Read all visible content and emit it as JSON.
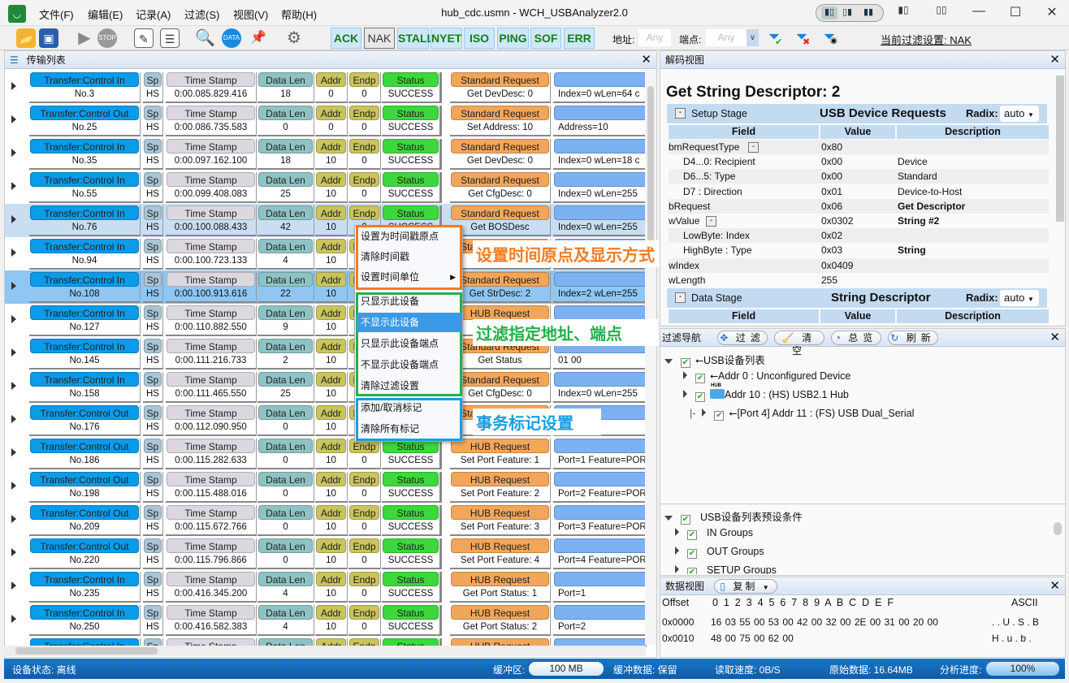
{
  "window": {
    "title": "hub_cdc.usmn - WCH_USBAnalyzer2.0",
    "menus": [
      "文件(F)",
      "编辑(E)",
      "记录(A)",
      "过滤(S)",
      "视图(V)",
      "帮助(H)"
    ]
  },
  "toolbar": {
    "packet_filters": [
      {
        "label": "ACK",
        "on": true
      },
      {
        "label": "NAK",
        "on": false
      },
      {
        "label": "STALL",
        "on": true
      },
      {
        "label": "NYET",
        "on": true
      },
      {
        "label": "ISO",
        "on": true
      },
      {
        "label": "PING",
        "on": true
      },
      {
        "label": "SOF",
        "on": true
      },
      {
        "label": "ERR",
        "on": true
      }
    ],
    "addr_label": "地址:",
    "addr_placeholder": "Any",
    "endp_label": "端点:",
    "endp_placeholder": "Any",
    "current_filter": "当前过滤设置:  NAK"
  },
  "transfer_list": {
    "title": "传输列表",
    "headers": {
      "sp": "Sp",
      "time": "Time Stamp",
      "len": "Data Len",
      "addr": "Addr",
      "endp": "Endp",
      "status": "Status"
    },
    "rows": [
      {
        "type": "Transfer:Control In",
        "no": "No.3",
        "sp": "HS",
        "time": "0:00.085.829.416",
        "len": "18",
        "addr": "0",
        "endp": "0",
        "status": "SUCCESS",
        "req": "Standard Request",
        "req_val": "Get DevDesc: 0",
        "desc": "Index=0  wLen=64  c"
      },
      {
        "type": "Transfer:Control Out",
        "no": "No.25",
        "sp": "HS",
        "time": "0:00.086.735.583",
        "len": "0",
        "addr": "0",
        "endp": "0",
        "status": "SUCCESS",
        "req": "Standard Request",
        "req_val": "Set Address: 10",
        "desc": "Address=10"
      },
      {
        "type": "Transfer:Control In",
        "no": "No.35",
        "sp": "HS",
        "time": "0:00.097.162.100",
        "len": "18",
        "addr": "10",
        "endp": "0",
        "status": "SUCCESS",
        "req": "Standard Request",
        "req_val": "Get DevDesc: 0",
        "desc": "Index=0  wLen=18  c"
      },
      {
        "type": "Transfer:Control In",
        "no": "No.55",
        "sp": "HS",
        "time": "0:00.099.408.083",
        "len": "25",
        "addr": "10",
        "endp": "0",
        "status": "SUCCESS",
        "req": "Standard Request",
        "req_val": "Get CfgDesc: 0",
        "desc": "Index=0  wLen=255"
      },
      {
        "type": "Transfer:Control In",
        "no": "No.76",
        "sp": "HS",
        "time": "0:00.100.088.433",
        "len": "42",
        "addr": "10",
        "endp": "0",
        "status": "SUCCESS",
        "req": "Standard Request",
        "req_val": "Get BOSDesc",
        "desc": "Index=0  wLen=255",
        "selected": 1
      },
      {
        "type": "Transfer:Control In",
        "no": "No.94",
        "sp": "HS",
        "time": "0:00.100.723.133",
        "len": "4",
        "addr": "10",
        "endp": "0",
        "status": "SUCCESS",
        "req": "Standard Request",
        "req_val": "G",
        "desc": ""
      },
      {
        "type": "Transfer:Control In",
        "no": "No.108",
        "sp": "HS",
        "time": "0:00.100.913.616",
        "len": "22",
        "addr": "10",
        "endp": "0",
        "status": "SUCCESS",
        "req": "Standard Request",
        "req_val": "Get StrDesc: 2",
        "desc": "Index=2  wLen=255",
        "selected": 2
      },
      {
        "type": "Transfer:Control In",
        "no": "No.127",
        "sp": "HS",
        "time": "0:00.110.882.550",
        "len": "9",
        "addr": "10",
        "endp": "0",
        "status": "SUCCESS",
        "req": "HUB Request",
        "req_val": "Get",
        "desc": ""
      },
      {
        "type": "Transfer:Control In",
        "no": "No.145",
        "sp": "HS",
        "time": "0:00.111.216.733",
        "len": "2",
        "addr": "10",
        "endp": "0",
        "status": "SUCCESS",
        "req": "Standard Request",
        "req_val": "Get Status",
        "desc": "01 00"
      },
      {
        "type": "Transfer:Control In",
        "no": "No.158",
        "sp": "HS",
        "time": "0:00.111.465.550",
        "len": "25",
        "addr": "10",
        "endp": "0",
        "status": "SUCCESS",
        "req": "Standard Request",
        "req_val": "Get CfgDesc: 0",
        "desc": "Index=0  wLen=255"
      },
      {
        "type": "Transfer:Control Out",
        "no": "No.176",
        "sp": "HS",
        "time": "0:00.112.090.950",
        "len": "0",
        "addr": "10",
        "endp": "0",
        "status": "SUCCESS",
        "req": "Standard Request",
        "req_val": "Set",
        "desc": "tion=1"
      },
      {
        "type": "Transfer:Control Out",
        "no": "No.186",
        "sp": "HS",
        "time": "0:00.115.282.633",
        "len": "0",
        "addr": "10",
        "endp": "0",
        "status": "SUCCESS",
        "req": "HUB Request",
        "req_val": "Set Port Feature: 1",
        "desc": "Port=1  Feature=POR"
      },
      {
        "type": "Transfer:Control Out",
        "no": "No.198",
        "sp": "HS",
        "time": "0:00.115.488.016",
        "len": "0",
        "addr": "10",
        "endp": "0",
        "status": "SUCCESS",
        "req": "HUB Request",
        "req_val": "Set Port Feature: 2",
        "desc": "Port=2  Feature=POR"
      },
      {
        "type": "Transfer:Control Out",
        "no": "No.209",
        "sp": "HS",
        "time": "0:00.115.672.766",
        "len": "0",
        "addr": "10",
        "endp": "0",
        "status": "SUCCESS",
        "req": "HUB Request",
        "req_val": "Set Port Feature: 3",
        "desc": "Port=3  Feature=POR"
      },
      {
        "type": "Transfer:Control Out",
        "no": "No.220",
        "sp": "HS",
        "time": "0:00.115.796.866",
        "len": "0",
        "addr": "10",
        "endp": "0",
        "status": "SUCCESS",
        "req": "HUB Request",
        "req_val": "Set Port Feature: 4",
        "desc": "Port=4  Feature=POR"
      },
      {
        "type": "Transfer:Control In",
        "no": "No.235",
        "sp": "HS",
        "time": "0:00.416.345.200",
        "len": "4",
        "addr": "10",
        "endp": "0",
        "status": "SUCCESS",
        "req": "HUB Request",
        "req_val": "Get Port Status: 1",
        "desc": "Port=1"
      },
      {
        "type": "Transfer:Control In",
        "no": "No.250",
        "sp": "HS",
        "time": "0:00.416.582.383",
        "len": "4",
        "addr": "10",
        "endp": "0",
        "status": "SUCCESS",
        "req": "HUB Request",
        "req_val": "Get Port Status: 2",
        "desc": "Port=2"
      },
      {
        "type": "Transfer:Control In",
        "no": "",
        "sp": "",
        "time": "",
        "len": "",
        "addr": "",
        "endp": "",
        "status": "",
        "req": "HUB Request",
        "req_val": "",
        "desc": ""
      }
    ]
  },
  "context_menu": {
    "items": [
      "设置为时间戳原点",
      "清除时间戳",
      "设置时间单位",
      "只显示此设备",
      "不显示此设备",
      "只显示此设备端点",
      "不显示此设备端点",
      "清除过滤设置",
      "添加/取消标记",
      "清除所有标记"
    ],
    "highlighted": "不显示此设备"
  },
  "annotations": {
    "time": "设置时间原点及显示方式",
    "filter": "过滤指定地址、端点",
    "mark": "事务标记设置"
  },
  "decode": {
    "panel_title": "解码视图",
    "title": "Get String Descriptor: 2",
    "setup": {
      "stage": "Setup Stage",
      "title": "USB Device Requests",
      "radix_label": "Radix:",
      "radix": "auto"
    },
    "columns": [
      "Field",
      "Value",
      "Description"
    ],
    "fields": [
      [
        "bmRequestType",
        "0x80",
        ""
      ],
      [
        "D4...0: Recipient",
        "0x00",
        "Device"
      ],
      [
        "D6...5: Type",
        "0x00",
        "Standard"
      ],
      [
        "D7     : Direction",
        "0x01",
        "Device-to-Host"
      ],
      [
        "bRequest",
        "0x06",
        "Get Descriptor"
      ],
      [
        "wValue",
        "0x0302",
        "String #2"
      ],
      [
        "LowByte: Index",
        "0x02",
        ""
      ],
      [
        "HighByte   : Type",
        "0x03",
        "String"
      ],
      [
        "wIndex",
        "0x0409",
        ""
      ],
      [
        "wLength",
        "255",
        ""
      ]
    ],
    "data": {
      "stage": "Data Stage",
      "title": "String Descriptor",
      "radix_label": "Radix:",
      "radix": "auto"
    }
  },
  "filter_nav": {
    "title": "过滤导航",
    "buttons": [
      "过滤",
      "清空",
      "总览",
      "刷新"
    ],
    "tree": [
      "USB设备列表",
      "Addr 0 : Unconfigured Device",
      "Addr 10 : (HS) USB2.1 Hub",
      "[Port 4]   Addr 11 : (FS) USB Dual_Serial"
    ],
    "hub_badge": "HUB",
    "presets": [
      "USB设备列表预设条件",
      "IN Groups",
      "OUT Groups",
      "SETUP Groups"
    ]
  },
  "data_view": {
    "title": "数据视图",
    "copy": "复制",
    "offset_label": "Offset",
    "cols": "0  1  2  3  4  5  6  7  8  9  A  B  C  D  E  F",
    "ascii_label": "ASCII",
    "lines": [
      {
        "offset": "0x0000",
        "hex": "16 03 55 00 53 00 42 00 32 00 2E 00 31 00 20 00",
        "ascii": ". . U . S . B"
      },
      {
        "offset": "0x0010",
        "hex": "48 00 75 00 62 00",
        "ascii": "H . u . b ."
      }
    ]
  },
  "status": {
    "device": "设备状态:  离线",
    "buffer_label": "缓冲区:",
    "buffer": "100 MB",
    "buffer_data": "缓冲数据:  保留",
    "read_speed": "读取速度:  0B/S",
    "raw": "原始数据:  16.64MB",
    "progress_label": "分析进度:",
    "progress": "100%",
    "progress_value": 100
  },
  "colors": {
    "transfer": "#0a9be9",
    "sp": "#a9c6d6",
    "time": "#dcd8e0",
    "len": "#8fc3c3",
    "addr": "#c9c45e",
    "status": "#3cd83c",
    "request": "#f2a65a",
    "desc": "#7db2f2",
    "statusbar": "#1265b5",
    "orange": "#f47b20",
    "green": "#22b04a",
    "blue": "#1a9de0"
  }
}
